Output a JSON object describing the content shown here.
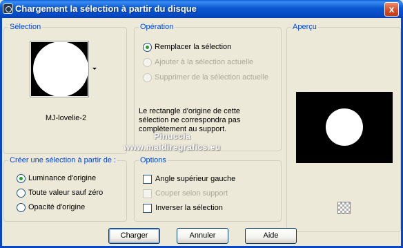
{
  "window": {
    "title": "Chargement la sélection à partir du disque",
    "close_glyph": "x"
  },
  "selection_group": {
    "title": "Sélection",
    "thumbnail_name": "MJ-lovelie-2"
  },
  "operation_group": {
    "title": "Opération",
    "options": [
      {
        "label": "Remplacer la sélection",
        "checked": true,
        "enabled": true
      },
      {
        "label": "Ajouter à la sélection actuelle",
        "checked": false,
        "enabled": false
      },
      {
        "label": "Supprimer de la sélection actuelle",
        "checked": false,
        "enabled": false
      }
    ],
    "note": "Le rectangle d'origine de cette sélection ne correspondra pas complètement au support."
  },
  "preview_group": {
    "title": "Aperçu"
  },
  "create_group": {
    "title": "Créer une sélection à partir de :",
    "options": [
      {
        "label": "Luminance d'origine",
        "checked": true
      },
      {
        "label": "Toute valeur sauf zéro",
        "checked": false
      },
      {
        "label": "Opacité d'origine",
        "checked": false
      }
    ]
  },
  "options_group": {
    "title": "Options",
    "options": [
      {
        "label": "Angle supérieur gauche",
        "checked": false,
        "enabled": true
      },
      {
        "label": "Couper selon support",
        "checked": false,
        "enabled": false
      },
      {
        "label": "Inverser la sélection",
        "checked": false,
        "enabled": true
      }
    ]
  },
  "watermark": {
    "line1": "Pinuccia",
    "line2": "www.maldiregrafics.eu"
  },
  "buttons": {
    "load": "Charger",
    "cancel": "Annuler",
    "help": "Aide"
  },
  "colors": {
    "titlebar": "#0a58d0",
    "group_title": "#0046d5",
    "radio_checked": "#21a121"
  }
}
